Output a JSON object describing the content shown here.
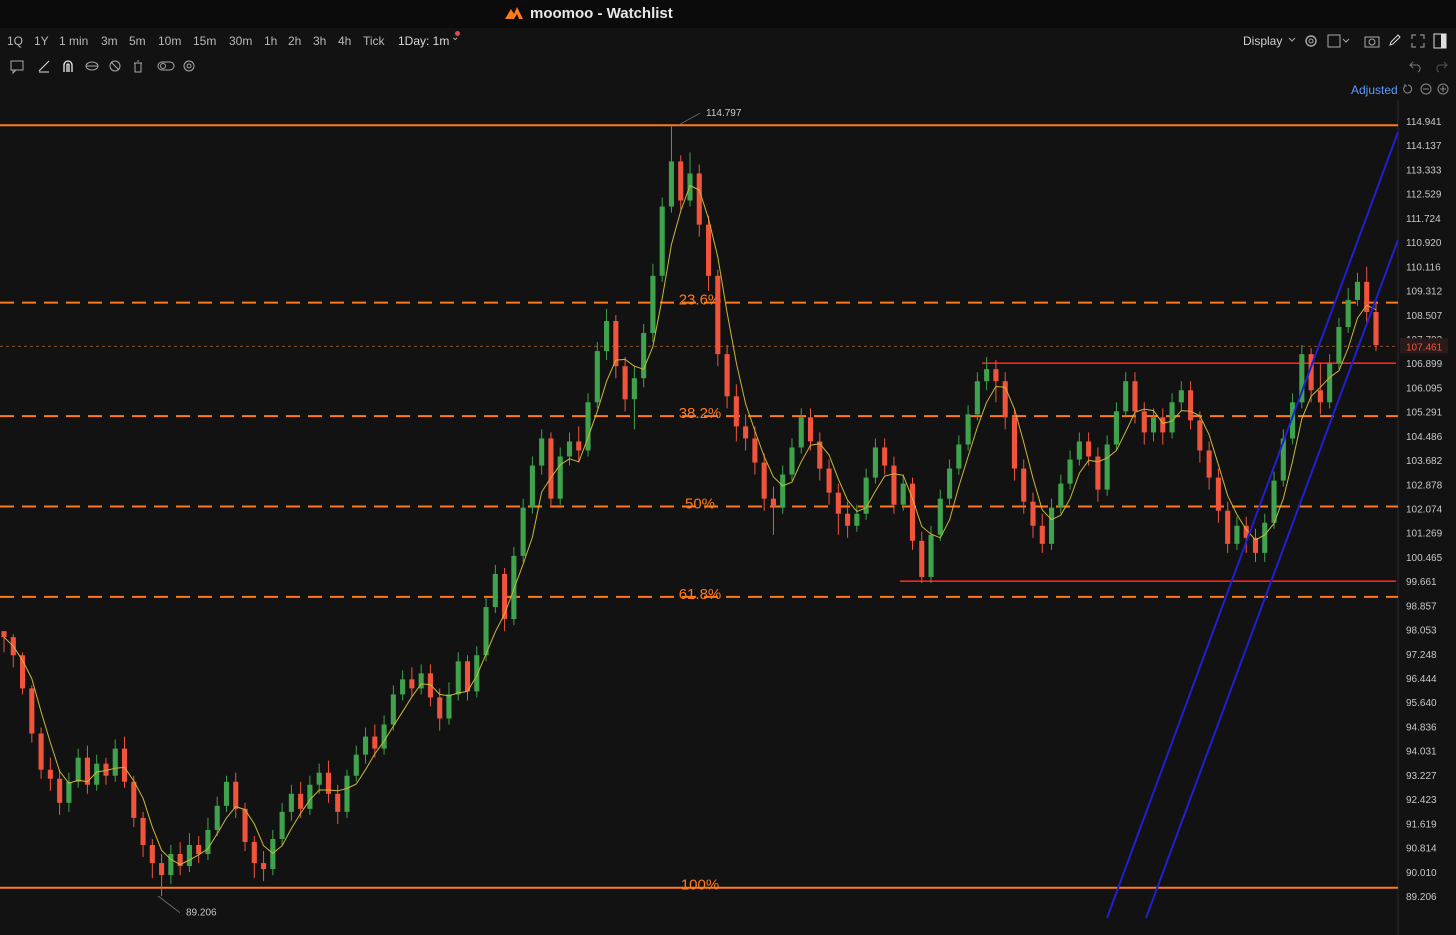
{
  "app": {
    "title": "moomoo - Watchlist"
  },
  "toolbar": {
    "timeframes": [
      "1Q",
      "1Y",
      "1 min",
      "3m",
      "5m",
      "10m",
      "15m",
      "30m",
      "1h",
      "2h",
      "3h",
      "4h",
      "Tick",
      "1Day: 1m"
    ],
    "display_label": "Display"
  },
  "price_mode_label": "Adjusted",
  "chart_data": {
    "type": "candlestick",
    "y_axis_ticks": [
      114.941,
      114.137,
      113.333,
      112.529,
      111.724,
      110.92,
      110.116,
      109.312,
      108.507,
      107.703,
      106.899,
      106.095,
      105.291,
      104.486,
      103.682,
      102.878,
      102.074,
      101.269,
      100.465,
      99.661,
      98.857,
      98.053,
      97.248,
      96.444,
      95.64,
      94.836,
      94.031,
      93.227,
      92.423,
      91.619,
      90.814,
      90.01,
      89.206
    ],
    "ylim": [
      88.9,
      115.5
    ],
    "current_price": "107.461",
    "high_label": "114.797",
    "low_label": "89.206",
    "fibonacci": {
      "levels": [
        {
          "label": "23.6%",
          "price": 108.91
        },
        {
          "label": "38.2%",
          "price": 105.14
        },
        {
          "label": "50%",
          "price": 102.14
        },
        {
          "label": "61.8%",
          "price": 99.14
        },
        {
          "label": "100%",
          "price": 89.48
        }
      ],
      "top_price": 114.8
    },
    "horizontal_lines": [
      106.9,
      99.66
    ],
    "colors": {
      "down": "#f0543c",
      "up": "#3fa34d",
      "fib": "#ff7a1a",
      "support": "#ff1f1f",
      "channel": "#2020d0",
      "ma": "#c9b83a"
    },
    "candles": [
      [
        98.0,
        97.8,
        98.0,
        97.3
      ],
      [
        97.8,
        97.2,
        97.9,
        96.8
      ],
      [
        97.2,
        96.1,
        97.3,
        95.9
      ],
      [
        96.1,
        94.6,
        96.2,
        94.3
      ],
      [
        94.6,
        93.4,
        94.8,
        93.1
      ],
      [
        93.4,
        93.1,
        93.8,
        92.7
      ],
      [
        93.1,
        92.3,
        93.4,
        91.9
      ],
      [
        92.3,
        93.0,
        93.3,
        92.0
      ],
      [
        93.0,
        93.8,
        94.1,
        92.8
      ],
      [
        93.8,
        92.9,
        94.2,
        92.6
      ],
      [
        92.9,
        93.6,
        93.9,
        92.7
      ],
      [
        93.6,
        93.2,
        93.8,
        92.9
      ],
      [
        93.2,
        94.1,
        94.4,
        93.0
      ],
      [
        94.1,
        93.0,
        94.5,
        92.8
      ],
      [
        93.0,
        91.8,
        93.2,
        91.5
      ],
      [
        91.8,
        90.9,
        92.0,
        90.5
      ],
      [
        90.9,
        90.3,
        91.1,
        89.8
      ],
      [
        90.3,
        89.9,
        90.6,
        89.2
      ],
      [
        89.9,
        90.6,
        90.9,
        89.6
      ],
      [
        90.6,
        90.2,
        91.0,
        89.9
      ],
      [
        90.2,
        90.9,
        91.3,
        90.0
      ],
      [
        90.9,
        90.6,
        91.2,
        90.3
      ],
      [
        90.6,
        91.4,
        91.8,
        90.4
      ],
      [
        91.4,
        92.2,
        92.5,
        91.2
      ],
      [
        92.2,
        93.0,
        93.2,
        92.0
      ],
      [
        93.0,
        92.1,
        93.3,
        91.8
      ],
      [
        92.1,
        91.0,
        92.3,
        90.7
      ],
      [
        91.0,
        90.3,
        91.2,
        89.8
      ],
      [
        90.3,
        90.1,
        90.7,
        89.7
      ],
      [
        90.1,
        91.1,
        91.4,
        89.9
      ],
      [
        91.1,
        92.0,
        92.3,
        90.9
      ],
      [
        92.0,
        92.6,
        92.9,
        91.7
      ],
      [
        92.6,
        92.1,
        93.0,
        91.8
      ],
      [
        92.1,
        92.9,
        93.2,
        91.9
      ],
      [
        92.9,
        93.3,
        93.6,
        92.6
      ],
      [
        93.3,
        92.6,
        93.7,
        92.3
      ],
      [
        92.6,
        92.0,
        92.9,
        91.6
      ],
      [
        92.0,
        93.2,
        93.4,
        91.8
      ],
      [
        93.2,
        93.9,
        94.2,
        93.0
      ],
      [
        93.9,
        94.5,
        94.8,
        93.6
      ],
      [
        94.5,
        94.1,
        94.9,
        93.8
      ],
      [
        94.1,
        94.9,
        95.2,
        93.9
      ],
      [
        94.9,
        95.9,
        96.2,
        94.7
      ],
      [
        95.9,
        96.4,
        96.7,
        95.7
      ],
      [
        96.4,
        96.1,
        96.8,
        95.8
      ],
      [
        96.1,
        96.6,
        96.9,
        95.9
      ],
      [
        96.6,
        95.8,
        96.9,
        95.5
      ],
      [
        95.8,
        95.1,
        96.1,
        94.7
      ],
      [
        95.1,
        95.9,
        96.3,
        94.9
      ],
      [
        95.9,
        97.0,
        97.3,
        95.7
      ],
      [
        97.0,
        96.0,
        97.2,
        95.7
      ],
      [
        96.0,
        97.2,
        97.5,
        95.8
      ],
      [
        97.2,
        98.8,
        99.1,
        97.0
      ],
      [
        98.8,
        99.9,
        100.2,
        98.6
      ],
      [
        99.9,
        98.4,
        100.1,
        98.0
      ],
      [
        98.4,
        100.5,
        100.8,
        98.2
      ],
      [
        100.5,
        102.1,
        102.4,
        100.3
      ],
      [
        102.1,
        103.5,
        103.8,
        101.9
      ],
      [
        103.5,
        104.4,
        104.7,
        103.2
      ],
      [
        104.4,
        102.4,
        104.6,
        102.1
      ],
      [
        102.4,
        103.8,
        104.1,
        102.2
      ],
      [
        103.8,
        104.3,
        104.6,
        103.5
      ],
      [
        104.3,
        104.0,
        104.8,
        103.6
      ],
      [
        104.0,
        105.6,
        105.9,
        103.8
      ],
      [
        105.6,
        107.3,
        107.6,
        105.4
      ],
      [
        107.3,
        108.3,
        108.7,
        107.0
      ],
      [
        108.3,
        106.8,
        108.5,
        106.4
      ],
      [
        106.8,
        105.7,
        107.1,
        105.3
      ],
      [
        105.7,
        106.4,
        106.8,
        104.7
      ],
      [
        106.4,
        107.9,
        108.2,
        106.1
      ],
      [
        107.9,
        109.8,
        110.2,
        107.6
      ],
      [
        109.8,
        112.1,
        112.4,
        109.6
      ],
      [
        112.1,
        113.6,
        114.8,
        111.9
      ],
      [
        113.6,
        112.3,
        113.8,
        112.0
      ],
      [
        112.3,
        113.2,
        113.9,
        112.1
      ],
      [
        113.2,
        111.5,
        113.5,
        111.1
      ],
      [
        111.5,
        109.8,
        111.8,
        109.3
      ],
      [
        109.8,
        107.2,
        110.0,
        106.8
      ],
      [
        107.2,
        105.8,
        107.5,
        105.4
      ],
      [
        105.8,
        104.8,
        106.2,
        104.3
      ],
      [
        104.8,
        104.4,
        105.2,
        104.0
      ],
      [
        104.4,
        103.6,
        104.8,
        103.2
      ],
      [
        103.6,
        102.4,
        103.9,
        102.0
      ],
      [
        102.4,
        102.1,
        102.8,
        101.2
      ],
      [
        102.1,
        103.2,
        103.5,
        101.9
      ],
      [
        103.2,
        104.1,
        104.4,
        103.0
      ],
      [
        104.1,
        105.1,
        105.4,
        103.9
      ],
      [
        105.1,
        104.3,
        105.4,
        104.0
      ],
      [
        104.3,
        103.4,
        104.6,
        103.0
      ],
      [
        103.4,
        102.6,
        103.7,
        102.2
      ],
      [
        102.6,
        101.9,
        102.9,
        101.2
      ],
      [
        101.9,
        101.5,
        102.3,
        101.1
      ],
      [
        101.5,
        101.9,
        102.2,
        101.3
      ],
      [
        101.9,
        103.1,
        103.4,
        101.7
      ],
      [
        103.1,
        104.1,
        104.4,
        102.9
      ],
      [
        104.1,
        103.5,
        104.4,
        103.2
      ],
      [
        103.5,
        102.2,
        103.8,
        101.9
      ],
      [
        102.2,
        102.9,
        103.2,
        102.0
      ],
      [
        102.9,
        101.0,
        103.1,
        100.7
      ],
      [
        101.0,
        99.8,
        101.3,
        99.6
      ],
      [
        99.8,
        101.2,
        101.5,
        99.6
      ],
      [
        101.2,
        102.4,
        102.7,
        101.0
      ],
      [
        102.4,
        103.4,
        103.7,
        102.2
      ],
      [
        103.4,
        104.2,
        104.5,
        103.2
      ],
      [
        104.2,
        105.2,
        105.5,
        104.0
      ],
      [
        105.2,
        106.3,
        106.6,
        105.0
      ],
      [
        106.3,
        106.7,
        107.1,
        106.0
      ],
      [
        106.7,
        106.3,
        107.0,
        105.6
      ],
      [
        106.3,
        105.1,
        106.6,
        104.7
      ],
      [
        105.1,
        103.4,
        105.4,
        103.0
      ],
      [
        103.4,
        102.3,
        103.7,
        101.9
      ],
      [
        102.3,
        101.5,
        102.6,
        101.1
      ],
      [
        101.5,
        100.9,
        101.9,
        100.6
      ],
      [
        100.9,
        102.1,
        102.4,
        100.7
      ],
      [
        102.1,
        102.9,
        103.2,
        101.9
      ],
      [
        102.9,
        103.7,
        104.0,
        102.7
      ],
      [
        103.7,
        104.3,
        104.6,
        103.5
      ],
      [
        104.3,
        103.8,
        104.6,
        103.5
      ],
      [
        103.8,
        102.7,
        104.1,
        102.3
      ],
      [
        102.7,
        104.2,
        104.5,
        102.5
      ],
      [
        104.2,
        105.3,
        105.6,
        104.0
      ],
      [
        105.3,
        106.3,
        106.6,
        105.1
      ],
      [
        106.3,
        105.3,
        106.6,
        104.9
      ],
      [
        105.3,
        104.6,
        105.6,
        104.2
      ],
      [
        104.6,
        105.1,
        105.4,
        104.3
      ],
      [
        105.1,
        104.6,
        105.4,
        104.2
      ],
      [
        104.6,
        105.6,
        105.9,
        104.4
      ],
      [
        105.6,
        106.0,
        106.3,
        105.3
      ],
      [
        106.0,
        105.0,
        106.3,
        104.7
      ],
      [
        105.0,
        104.0,
        105.3,
        103.6
      ],
      [
        104.0,
        103.1,
        104.3,
        102.7
      ],
      [
        103.1,
        102.0,
        103.4,
        101.6
      ],
      [
        102.0,
        100.9,
        102.3,
        100.6
      ],
      [
        100.9,
        101.5,
        101.8,
        100.7
      ],
      [
        101.5,
        101.1,
        101.8,
        100.6
      ],
      [
        101.1,
        100.6,
        101.4,
        100.3
      ],
      [
        100.6,
        101.6,
        101.9,
        100.3
      ],
      [
        101.6,
        103.0,
        103.3,
        101.4
      ],
      [
        103.0,
        104.4,
        104.7,
        102.8
      ],
      [
        104.4,
        105.6,
        105.9,
        104.2
      ],
      [
        105.6,
        107.2,
        107.5,
        105.4
      ],
      [
        107.2,
        106.0,
        107.4,
        105.6
      ],
      [
        106.0,
        105.6,
        106.9,
        105.2
      ],
      [
        105.6,
        106.9,
        107.2,
        105.4
      ],
      [
        106.9,
        108.1,
        108.4,
        106.7
      ],
      [
        108.1,
        109.0,
        109.4,
        107.9
      ],
      [
        109.0,
        109.6,
        109.9,
        108.8
      ],
      [
        109.6,
        108.6,
        110.1,
        108.2
      ],
      [
        108.6,
        107.5,
        108.9,
        107.3
      ]
    ]
  }
}
